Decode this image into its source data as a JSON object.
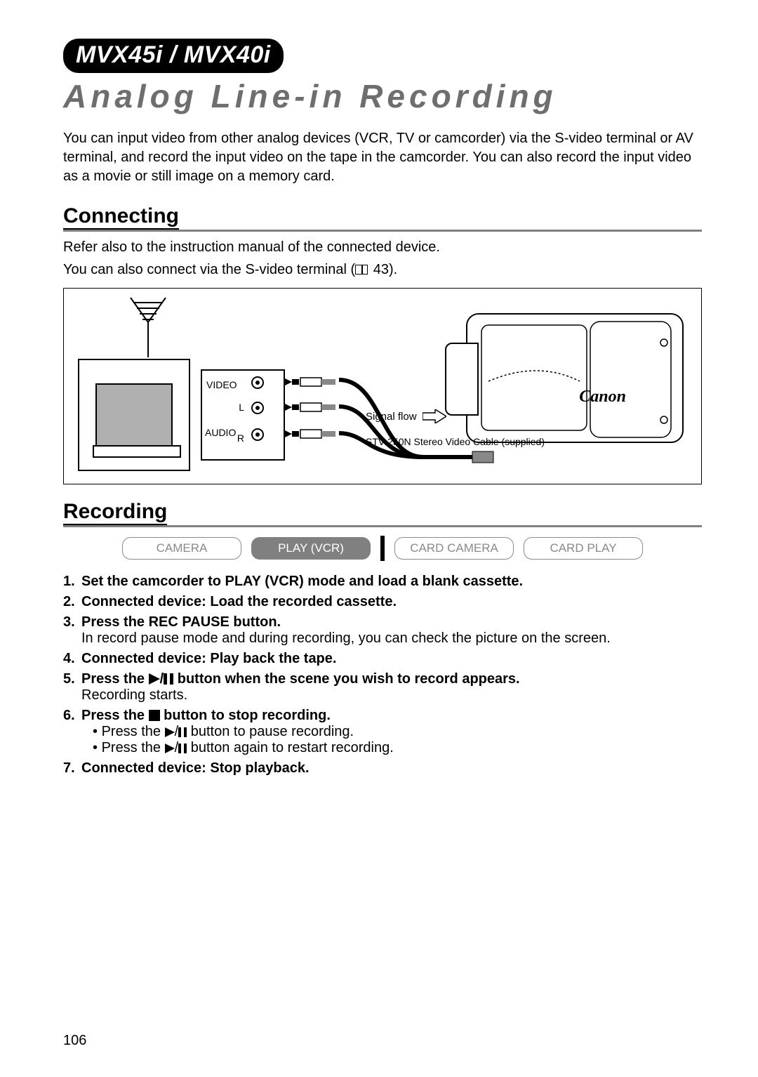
{
  "model_badge": "MVX45i / MVX40i",
  "title": "Analog Line-in Recording",
  "intro": "You can input video from other analog devices (VCR, TV or camcorder) via the S-video terminal or AV terminal, and record the input video on the tape in the camcorder. You can also record the input video as a movie or still image on a memory card.",
  "section_connecting": "Connecting",
  "connecting_line1": "Refer also to the instruction manual of the connected device.",
  "connecting_line2_a": "You can also connect via the S-video terminal (",
  "connecting_line2_b": " 43).",
  "diagram": {
    "video_label": "VIDEO",
    "audio_label": "AUDIO",
    "l_label": "L",
    "r_label": "R",
    "signal_flow": "Signal flow",
    "cable_note": "STV-250N Stereo Video Cable (supplied)",
    "brand": "Canon"
  },
  "section_recording": "Recording",
  "modes": {
    "camera": "CAMERA",
    "play_vcr": "PLAY (VCR)",
    "card_camera": "CARD CAMERA",
    "card_play": "CARD PLAY"
  },
  "steps": {
    "s1": "Set the camcorder to PLAY (VCR) mode and load a blank cassette.",
    "s2": "Connected device: Load the recorded cassette.",
    "s3": "Press the REC PAUSE button.",
    "s3_body": "In record pause mode and during recording, you can check the picture on the screen.",
    "s4": "Connected device: Play back the tape.",
    "s5_a": "Press the ",
    "s5_b": " button when the scene you wish to record appears.",
    "s5_body": "Recording starts.",
    "s6_a": "Press the ",
    "s6_b": " button to stop recording.",
    "s6_sub1_a": "Press the ",
    "s6_sub1_b": " button to pause recording.",
    "s6_sub2_a": "Press the ",
    "s6_sub2_b": " button again to restart recording.",
    "s7": "Connected device: Stop playback."
  },
  "page_number": "106"
}
